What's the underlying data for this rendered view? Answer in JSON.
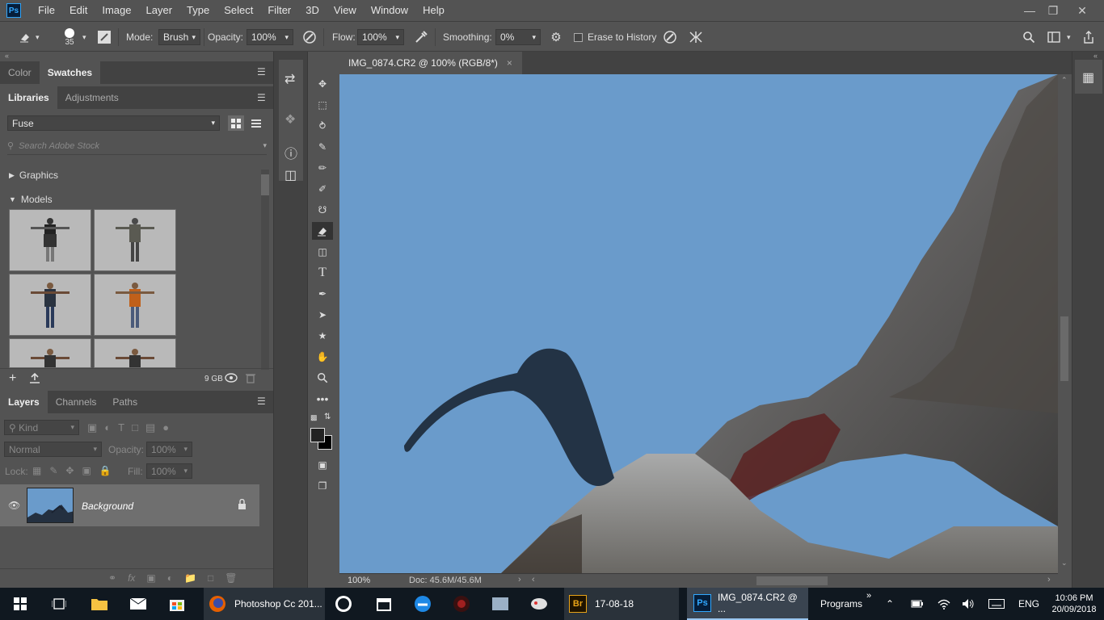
{
  "app": {
    "logo": "Ps"
  },
  "menu": [
    "File",
    "Edit",
    "Image",
    "Layer",
    "Type",
    "Select",
    "Filter",
    "3D",
    "View",
    "Window",
    "Help"
  ],
  "options": {
    "brush_size": "35",
    "mode_label": "Mode:",
    "mode_value": "Brush",
    "opacity_label": "Opacity:",
    "opacity_value": "100%",
    "flow_label": "Flow:",
    "flow_value": "100%",
    "smoothing_label": "Smoothing:",
    "smoothing_value": "0%",
    "erase_to_history": "Erase to History"
  },
  "panel_top": {
    "tabs": [
      "Color",
      "Swatches"
    ]
  },
  "libraries": {
    "tabs": [
      "Libraries",
      "Adjustments"
    ],
    "library_name": "Fuse",
    "search_placeholder": "Search Adobe Stock",
    "group_graphics": "Graphics",
    "group_models": "Models",
    "storage": "9 GB"
  },
  "layers_panel": {
    "tabs": [
      "Layers",
      "Channels",
      "Paths"
    ],
    "filter_kind": "Kind",
    "blend_mode": "Normal",
    "opacity_label": "Opacity:",
    "opacity_value": "100%",
    "lock_label": "Lock:",
    "fill_label": "Fill:",
    "fill_value": "100%",
    "layer_name": "Background"
  },
  "document": {
    "tab_title": "IMG_0874.CR2 @ 100% (RGB/8*)",
    "zoom": "100%",
    "doc_info": "Doc: 45.6M/45.6M"
  },
  "taskbar": {
    "item_firefox": "Photoshop Cc 201...",
    "item_bridge": "17-08-18",
    "item_ps": "IMG_0874.CR2 @ ...",
    "programs": "Programs",
    "lang": "ENG",
    "time": "10:06 PM",
    "date": "20/09/2018"
  },
  "colors": {
    "sky": "#6a9bcb",
    "ui_bg": "#535353",
    "taskbar": "#101820",
    "ps_blue": "#31a8ff"
  }
}
